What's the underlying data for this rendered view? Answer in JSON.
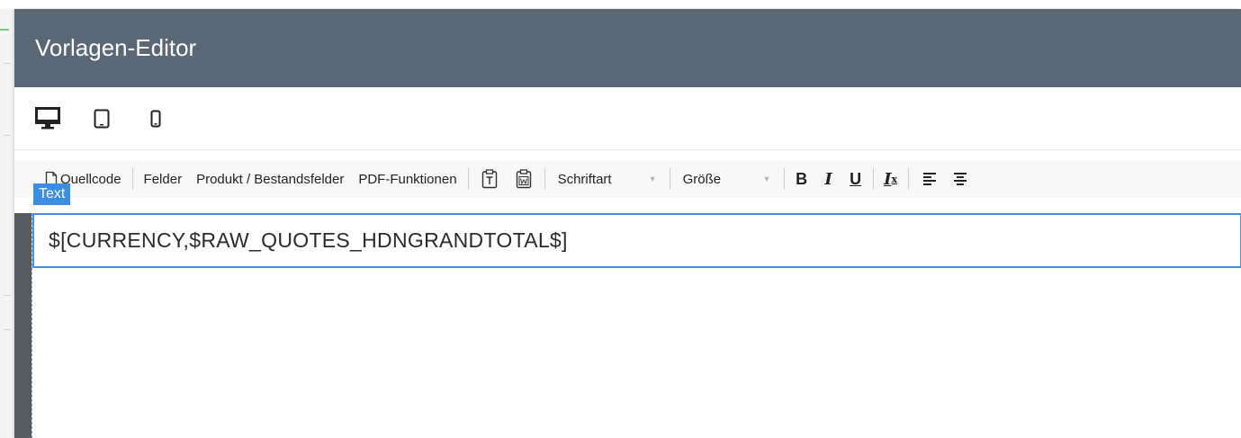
{
  "modal": {
    "title": "Vorlagen-Editor"
  },
  "device_bar": {
    "items": [
      {
        "icon": "desktop-icon"
      },
      {
        "icon": "tablet-icon"
      },
      {
        "icon": "phone-icon"
      }
    ]
  },
  "toolbar": {
    "source_label": "Quellcode",
    "fields_label": "Felder",
    "product_fields_label": "Produkt / Bestandsfelder",
    "pdf_label": "PDF-Funktionen",
    "paste_text_icon": "paste-as-text-icon",
    "paste_word_icon": "paste-from-word-icon",
    "font_label": "Schriftart",
    "size_label": "Größe",
    "bold_label": "B",
    "italic_label": "I",
    "underline_label": "U",
    "clear_format_label": "I",
    "clear_format_sub": "x",
    "align_icons": [
      "align-left-icon",
      "align-center-icon"
    ]
  },
  "editor": {
    "block_tag": "Text",
    "content": "$[CURRENCY,$RAW_QUOTES_HDNGRANDTOTAL$]"
  },
  "colors": {
    "header_bg": "#5a6876",
    "accent": "#3d8ee0",
    "focus_border": "#4a90d9"
  }
}
